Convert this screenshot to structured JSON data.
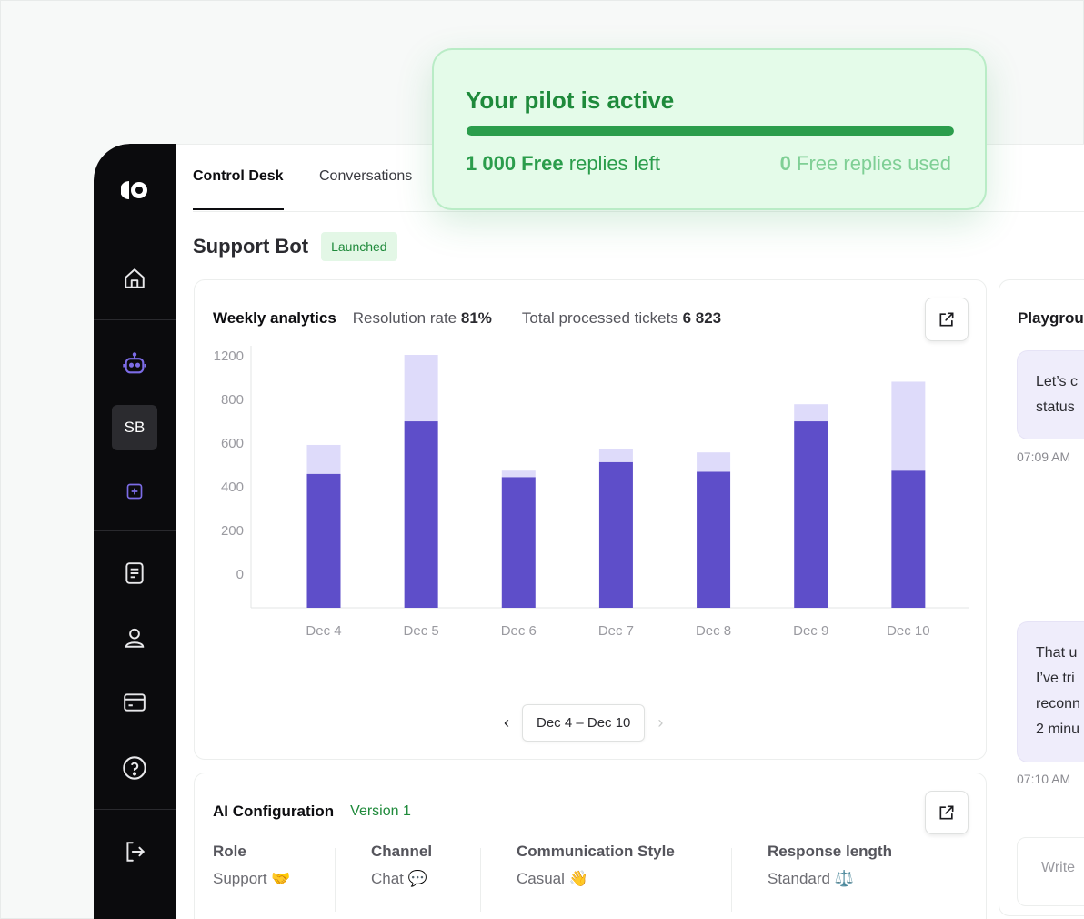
{
  "pilot": {
    "title": "Your pilot is active",
    "replies_left_value": "1 000 Free",
    "replies_left_suffix": " replies left",
    "replies_used_value": "0",
    "replies_used_suffix": " Free replies used",
    "progress": 1.0,
    "accent": "#2b9d4c"
  },
  "sidebar": {
    "avatar": "SB",
    "icons": [
      "home-icon",
      "robot-icon",
      "plus-square-icon",
      "document-icon",
      "user-icon",
      "card-icon",
      "help-icon",
      "logout-icon"
    ]
  },
  "tabs": [
    "Control Desk",
    "Conversations"
  ],
  "bot": {
    "name": "Support Bot",
    "status": "Launched"
  },
  "analytics": {
    "title": "Weekly analytics",
    "resolution_label": "Resolution rate ",
    "resolution_value": "81%",
    "tickets_label": "Total processed tickets ",
    "tickets_value": "6 823",
    "range": "Dec 4 – Dec 10"
  },
  "chart_data": {
    "type": "bar",
    "stacked": true,
    "categories": [
      "Dec 4",
      "Dec 5",
      "Dec 6",
      "Dec 7",
      "Dec 8",
      "Dec 9",
      "Dec 10"
    ],
    "y_ticks": [
      "1200",
      "800",
      "600",
      "400",
      "200",
      "0"
    ],
    "series": [
      {
        "values": [
          625,
          870,
          610,
          680,
          635,
          870,
          640
        ],
        "color": "#5e4ec9"
      },
      {
        "values": [
          135,
          310,
          30,
          60,
          90,
          80,
          415
        ],
        "color": "#dedbfa"
      }
    ],
    "ylim": [
      0,
      1180
    ],
    "grid": false
  },
  "config": {
    "title": "AI Configuration",
    "version": "Version 1",
    "items": [
      {
        "label": "Role",
        "value": "Support 🤝"
      },
      {
        "label": "Channel",
        "value": "Chat 💬"
      },
      {
        "label": "Communication Style",
        "value": "Casual 👋"
      },
      {
        "label": "Response length",
        "value": "Standard ⚖️"
      }
    ]
  },
  "playground": {
    "title": "Playground",
    "bubble1": [
      "Let’s c",
      "status"
    ],
    "time1": "07:09 AM",
    "bubble2": [
      "That u",
      "I’ve tri",
      "reconn",
      "2 minu"
    ],
    "time2": "07:10 AM",
    "input_placeholder": "Write"
  }
}
